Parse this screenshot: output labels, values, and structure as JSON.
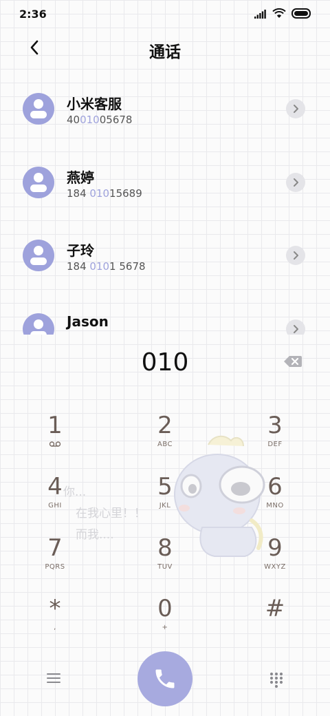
{
  "status_bar": {
    "time": "2:36"
  },
  "header": {
    "title": "通话"
  },
  "contacts": [
    {
      "name": "小米客服",
      "number_pre": "40",
      "number_hl": "010",
      "number_post": "05678"
    },
    {
      "name": "燕婷",
      "number_pre": "184 ",
      "number_hl": "010",
      "number_post": "15689"
    },
    {
      "name": "子玲",
      "number_pre": "184 ",
      "number_hl": "010",
      "number_post": "1 5678"
    },
    {
      "name": "Jason",
      "number_pre": "",
      "number_hl": "",
      "number_post": ""
    }
  ],
  "dialer": {
    "input": "010",
    "keys": [
      {
        "digit": "1",
        "letters": ""
      },
      {
        "digit": "2",
        "letters": "ABC"
      },
      {
        "digit": "3",
        "letters": "DEF"
      },
      {
        "digit": "4",
        "letters": "GHI"
      },
      {
        "digit": "5",
        "letters": "JKL"
      },
      {
        "digit": "6",
        "letters": "MNO"
      },
      {
        "digit": "7",
        "letters": "PQRS"
      },
      {
        "digit": "8",
        "letters": "TUV"
      },
      {
        "digit": "9",
        "letters": "WXYZ"
      },
      {
        "digit": "*",
        "letters": ","
      },
      {
        "digit": "0",
        "letters": "+"
      },
      {
        "digit": "#",
        "letters": ""
      }
    ]
  },
  "wallpaper_text": {
    "line1": "你...",
    "line2": "在我心里！！",
    "line3": "而我...."
  },
  "colors": {
    "accent": "#9ea2dc",
    "call_button": "#a7aadf",
    "keypad_digit": "#6a5d57"
  },
  "icons": [
    "back-arrow-icon",
    "chevron-right-icon",
    "backspace-icon",
    "voicemail-icon",
    "menu-icon",
    "phone-icon",
    "dialpad-icon",
    "signal-icon",
    "wifi-icon",
    "battery-icon"
  ]
}
